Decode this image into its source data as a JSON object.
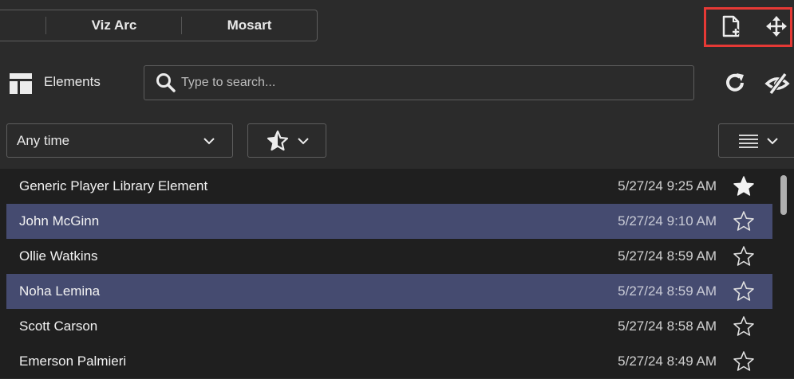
{
  "tabs": [
    {
      "label": ""
    },
    {
      "label": "Viz Arc"
    },
    {
      "label": "Mosart"
    }
  ],
  "toolbar": {
    "new_icon": "new-document-icon",
    "move_icon": "move-arrows-icon"
  },
  "elements": {
    "label": "Elements",
    "search_placeholder": "Type to search...",
    "search_value": "",
    "refresh_icon": "refresh-icon",
    "hide_icon": "eye-slash-icon"
  },
  "filters": {
    "time_value": "Any time",
    "favorite_icon": "star-half-icon",
    "view_icon": "list-lines-icon"
  },
  "list": [
    {
      "name": "Generic Player Library Element",
      "time": "5/27/24 9:25 AM",
      "favorite": true,
      "selected": false
    },
    {
      "name": "John McGinn",
      "time": "5/27/24 9:10 AM",
      "favorite": false,
      "selected": true
    },
    {
      "name": "Ollie Watkins",
      "time": "5/27/24 8:59 AM",
      "favorite": false,
      "selected": false
    },
    {
      "name": "Noha Lemina",
      "time": "5/27/24 8:59 AM",
      "favorite": false,
      "selected": true
    },
    {
      "name": "Scott Carson",
      "time": "5/27/24 8:58 AM",
      "favorite": false,
      "selected": false
    },
    {
      "name": "Emerson Palmieri",
      "time": "5/27/24 8:49 AM",
      "favorite": false,
      "selected": false
    }
  ],
  "colors": {
    "background": "#2b2b2b",
    "list_background": "#1f1f1f",
    "selected_row": "#454b70",
    "highlight": "#e53935"
  }
}
